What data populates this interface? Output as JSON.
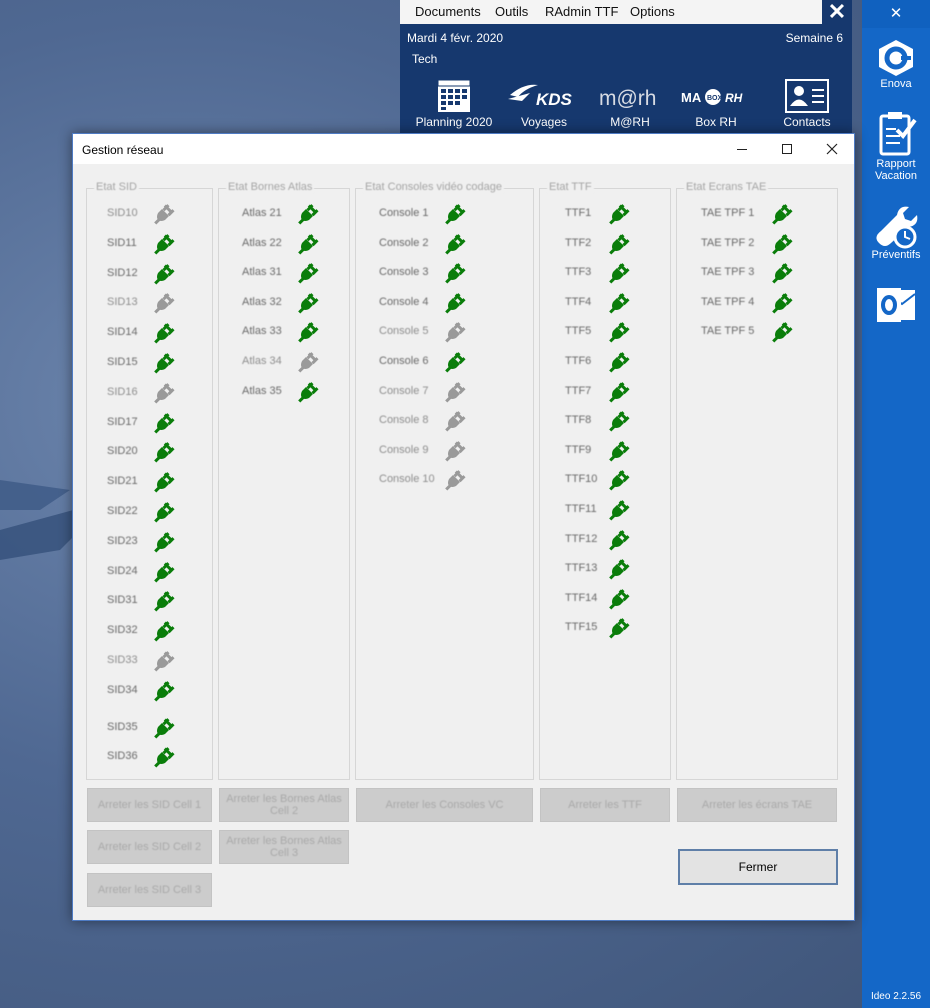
{
  "topbar": {
    "menu": [
      "Documents",
      "Outils",
      "RAdmin TTF",
      "Options"
    ],
    "date": "Mardi 4 févr. 2020",
    "week": "Semaine 6",
    "user": "Tech",
    "tiles": [
      {
        "label": "Planning 2020",
        "icon": "calendar-icon"
      },
      {
        "label": "Voyages",
        "icon": "kds-logo-icon"
      },
      {
        "label": "M@RH",
        "icon": "marh-logo-icon"
      },
      {
        "label": "Box RH",
        "icon": "boxrh-logo-icon"
      },
      {
        "label": "Contacts",
        "icon": "contact-card-icon"
      }
    ]
  },
  "sidebar": {
    "items": [
      {
        "label": "Enova",
        "icon": "enova-hex-icon"
      },
      {
        "label": "Rapport Vacation",
        "icon": "clipboard-check-icon"
      },
      {
        "label": "Préventifs",
        "icon": "wrench-clock-icon"
      },
      {
        "label": "",
        "icon": "outlook-icon"
      }
    ],
    "version": "Ideo 2.2.56"
  },
  "dialog": {
    "title": "Gestion réseau",
    "colors": {
      "connected": "#0a7d0a",
      "disconnected": "#9a9a9a"
    },
    "groups": [
      {
        "title": "Etat SID",
        "items": [
          {
            "name": "SID10",
            "connected": false
          },
          {
            "name": "SID11",
            "connected": true
          },
          {
            "name": "SID12",
            "connected": true
          },
          {
            "name": "SID13",
            "connected": false
          },
          {
            "name": "SID14",
            "connected": true
          },
          {
            "name": "SID15",
            "connected": true
          },
          {
            "name": "SID16",
            "connected": false
          },
          {
            "name": "SID17",
            "connected": true
          },
          {
            "name": "SID20",
            "connected": true
          },
          {
            "name": "SID21",
            "connected": true
          },
          {
            "name": "SID22",
            "connected": true
          },
          {
            "name": "SID23",
            "connected": true
          },
          {
            "name": "SID24",
            "connected": true
          },
          {
            "name": "SID31",
            "connected": true
          },
          {
            "name": "SID32",
            "connected": true
          },
          {
            "name": "SID33",
            "connected": false
          },
          {
            "name": "SID34",
            "connected": true
          },
          {
            "name": "SID35",
            "connected": true
          },
          {
            "name": "SID36",
            "connected": true
          }
        ]
      },
      {
        "title": "Etat Bornes Atlas",
        "items": [
          {
            "name": "Atlas 21",
            "connected": true
          },
          {
            "name": "Atlas 22",
            "connected": true
          },
          {
            "name": "Atlas 31",
            "connected": true
          },
          {
            "name": "Atlas 32",
            "connected": true
          },
          {
            "name": "Atlas 33",
            "connected": true
          },
          {
            "name": "Atlas 34",
            "connected": false
          },
          {
            "name": "Atlas 35",
            "connected": true
          }
        ]
      },
      {
        "title": "Etat Consoles vidéo codage",
        "items": [
          {
            "name": "Console 1",
            "connected": true
          },
          {
            "name": "Console 2",
            "connected": true
          },
          {
            "name": "Console 3",
            "connected": true
          },
          {
            "name": "Console 4",
            "connected": true
          },
          {
            "name": "Console 5",
            "connected": false
          },
          {
            "name": "Console 6",
            "connected": true
          },
          {
            "name": "Console 7",
            "connected": false
          },
          {
            "name": "Console 8",
            "connected": false
          },
          {
            "name": "Console 9",
            "connected": false
          },
          {
            "name": "Console 10",
            "connected": false
          }
        ]
      },
      {
        "title": "Etat TTF",
        "items": [
          {
            "name": "TTF1",
            "connected": true
          },
          {
            "name": "TTF2",
            "connected": true
          },
          {
            "name": "TTF3",
            "connected": true
          },
          {
            "name": "TTF4",
            "connected": true
          },
          {
            "name": "TTF5",
            "connected": true
          },
          {
            "name": "TTF6",
            "connected": true
          },
          {
            "name": "TTF7",
            "connected": true
          },
          {
            "name": "TTF8",
            "connected": true
          },
          {
            "name": "TTF9",
            "connected": true
          },
          {
            "name": "TTF10",
            "connected": true
          },
          {
            "name": "TTF11",
            "connected": true
          },
          {
            "name": "TTF12",
            "connected": true
          },
          {
            "name": "TTF13",
            "connected": true
          },
          {
            "name": "TTF14",
            "connected": true
          },
          {
            "name": "TTF15",
            "connected": true
          }
        ]
      },
      {
        "title": "Etat Ecrans TAE",
        "items": [
          {
            "name": "TAE TPF 1",
            "connected": true
          },
          {
            "name": "TAE TPF 2",
            "connected": true
          },
          {
            "name": "TAE TPF 3",
            "connected": true
          },
          {
            "name": "TAE TPF 4",
            "connected": true
          },
          {
            "name": "TAE TPF 5",
            "connected": true
          }
        ]
      }
    ],
    "buttons": {
      "sid1": "Arreter les SID Cell 1",
      "sid2": "Arreter les SID Cell 2",
      "sid3": "Arreter les SID Cell 3",
      "atlas2": "Arreter les Bornes Atlas Cell 2",
      "atlas3": "Arreter les Bornes Atlas Cell 3",
      "consoles": "Arreter les Consoles VC",
      "ttf": "Arreter les TTF",
      "tae": "Arreter les écrans TAE",
      "close": "Fermer"
    }
  }
}
